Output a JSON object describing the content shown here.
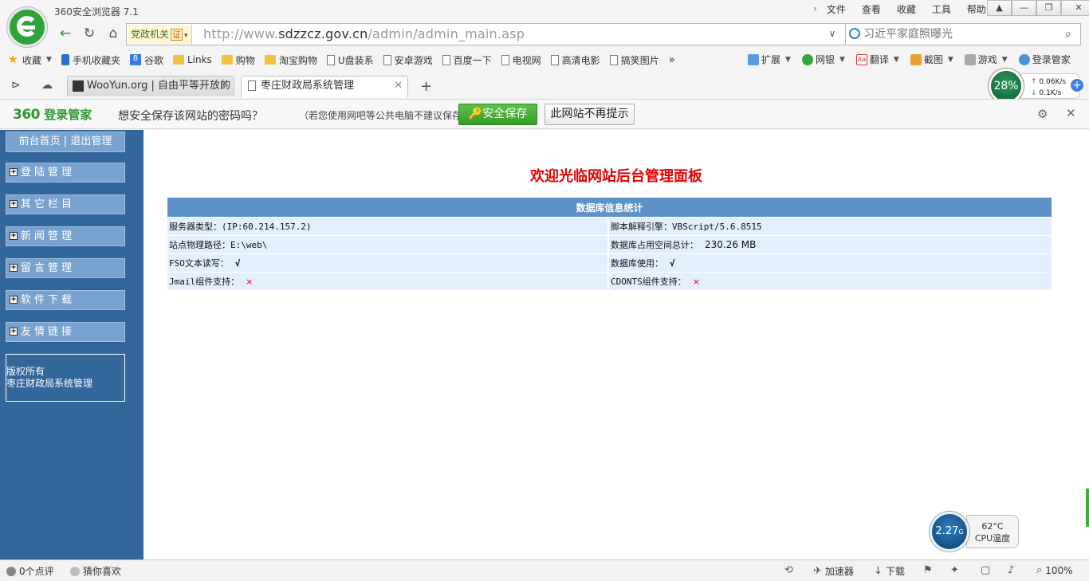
{
  "browser": {
    "window_title": "360安全浏览器 7.1",
    "menu": [
      "文件",
      "查看",
      "收藏",
      "工具",
      "帮助"
    ],
    "address": {
      "badge_label": "党政机关",
      "badge_cert": "证",
      "url_prefix": "http://www.",
      "url_host": "sdzzcz.gov.cn",
      "url_path": "/admin/admin_main.asp"
    },
    "search": {
      "placeholder": "习近平家庭照曝光"
    },
    "bookmarks": [
      "收藏",
      "手机收藏夹",
      "谷歌",
      "Links",
      "购物",
      "淘宝购物",
      "U盘装系",
      "安卓游戏",
      "百度一下",
      "电视网",
      "高清电影",
      "搞笑图片"
    ],
    "tools": [
      "扩展",
      "网银",
      "翻译",
      "截图",
      "游戏",
      "登录管家"
    ],
    "tabs": [
      {
        "label": "WooYun.org | 自由平等开放的"
      },
      {
        "label": "枣庄财政局系统管理"
      }
    ],
    "network": {
      "cpu_percent": "28%",
      "up": "0.06K/s",
      "down": "0.1K/s"
    },
    "password_bar": {
      "brand_num": "360",
      "brand_text": "登录管家",
      "question": "想安全保存该网站的密码吗？",
      "hint": "（若您使用网吧等公共电脑不建议保存）",
      "save_label": "安全保存",
      "never_label": "此网站不再提示"
    },
    "status": {
      "comments": "0个点评",
      "recommend": "猜你喜欢",
      "accelerator": "加速器",
      "download": "下载",
      "zoom": "100%"
    },
    "cpu_widget": {
      "ghz": "2.27",
      "ghz_unit": "G",
      "temp": "62°C",
      "label": "CPU温度"
    }
  },
  "admin": {
    "top_links": "前台首页 | 退出管理",
    "menu": [
      "登陆管理",
      "其它栏目",
      "新闻管理",
      "留言管理",
      "软件下载",
      "友情链接"
    ],
    "copyright_line1": "版权所有",
    "copyright_line2": "枣庄财政局系统管理",
    "welcome": "欢迎光临网站后台管理面板",
    "stats_title": "数据库信息统计",
    "stats": [
      {
        "left_label": "服务器类型：",
        "left_value": "(IP:60.214.157.2)",
        "right_label": "脚本解释引擎：",
        "right_value": "VBScript/5.6.8515"
      },
      {
        "left_label": "站点物理路径：",
        "left_value": "E:\\web\\",
        "right_label": "数据库占用空间总计：",
        "right_value": "230.26 MB"
      },
      {
        "left_label": "FSO文本读写：",
        "left_value": "√",
        "right_label": "数据库使用：",
        "right_value": "√"
      },
      {
        "left_label": "Jmail组件支持：",
        "left_value": "×",
        "right_label": "CDONTS组件支持：",
        "right_value": "×"
      }
    ]
  }
}
